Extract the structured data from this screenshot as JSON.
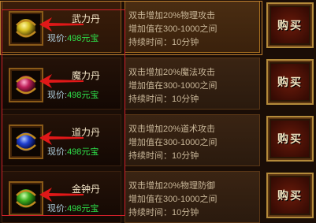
{
  "items": [
    {
      "name": "武力丹",
      "price_label": "现价:",
      "price_value": "498元宝",
      "desc": [
        "双击增加20%物理攻击",
        "增加值在300-1000之间",
        "持续时间：10分钟"
      ],
      "buy_label": "购买",
      "orb_color": "#d8c020",
      "icon": "yellow-orb-icon"
    },
    {
      "name": "魔力丹",
      "price_label": "现价:",
      "price_value": "498元宝",
      "desc": [
        "双击增加20%魔法攻击",
        "增加值在300-1000之间",
        "持续时间：10分钟"
      ],
      "buy_label": "购买",
      "orb_color": "#c0205a",
      "icon": "magenta-orb-icon"
    },
    {
      "name": "道力丹",
      "price_label": "现价:",
      "price_value": "498元宝",
      "desc": [
        "双击增加20%道术攻击",
        "增加值在300-1000之间",
        "持续时间：10分钟"
      ],
      "buy_label": "购买",
      "orb_color": "#2040d0",
      "icon": "blue-orb-icon"
    },
    {
      "name": "金钟丹",
      "price_label": "现价:",
      "price_value": "498元宝",
      "desc": [
        "双击增加20%物理防御",
        "增加值在300-1000之间",
        "持续时间：10分钟"
      ],
      "buy_label": "购买",
      "orb_color": "#40b020",
      "icon": "green-orb-icon"
    }
  ],
  "colors": {
    "price_value": "#2ee04a",
    "arrow": "#e01818",
    "highlight_border": "#d0202a"
  }
}
